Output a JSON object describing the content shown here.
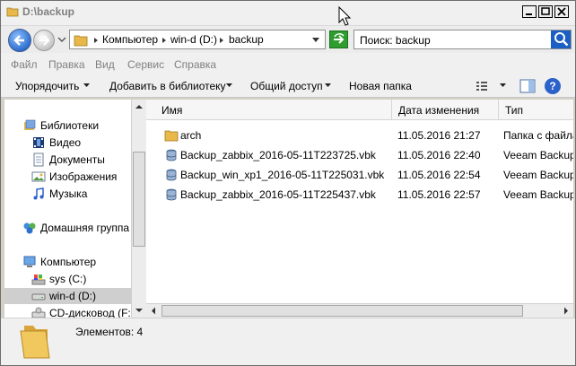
{
  "window": {
    "title": "D:\\backup"
  },
  "address": {
    "segments": [
      "Компьютер",
      "win-d (D:)",
      "backup"
    ]
  },
  "search": {
    "text": "Поиск: backup"
  },
  "menu": [
    "Файл",
    "Правка",
    "Вид",
    "Сервис",
    "Справка"
  ],
  "commands": {
    "organize": "Упорядочить",
    "add_to_library": "Добавить в библиотеку",
    "share": "Общий доступ",
    "new_folder": "Новая папка",
    "help": "?"
  },
  "nav": {
    "libraries": "Библиотеки",
    "video": "Видео",
    "documents": "Документы",
    "images": "Изображения",
    "music": "Музыка",
    "homegroup": "Домашняя группа",
    "computer": "Компьютер",
    "drive_c": "sys (C:)",
    "drive_d": "win-d (D:)",
    "cd": "CD-дисковод (F:)"
  },
  "columns": {
    "name": "Имя",
    "date": "Дата изменения",
    "type": "Тип"
  },
  "files": [
    {
      "name": "arch",
      "date": "11.05.2016 21:27",
      "type": "Папка с файлами",
      "icon": "folder-icon"
    },
    {
      "name": "Backup_zabbix_2016-05-11T223725.vbk",
      "date": "11.05.2016 22:40",
      "type": "Veeam Backup & Replication",
      "icon": "database-icon"
    },
    {
      "name": "Backup_win_xp1_2016-05-11T225031.vbk",
      "date": "11.05.2016 22:54",
      "type": "Veeam Backup & Replication",
      "icon": "database-icon"
    },
    {
      "name": "Backup_zabbix_2016-05-11T225437.vbk",
      "date": "11.05.2016 22:57",
      "type": "Veeam Backup & Replication",
      "icon": "database-icon"
    }
  ],
  "details": {
    "count_text": "Элементов: 4"
  },
  "colors": {
    "selection": "#cfcfcf",
    "folder": "#e8b84a",
    "accent": "#2a62c9"
  }
}
